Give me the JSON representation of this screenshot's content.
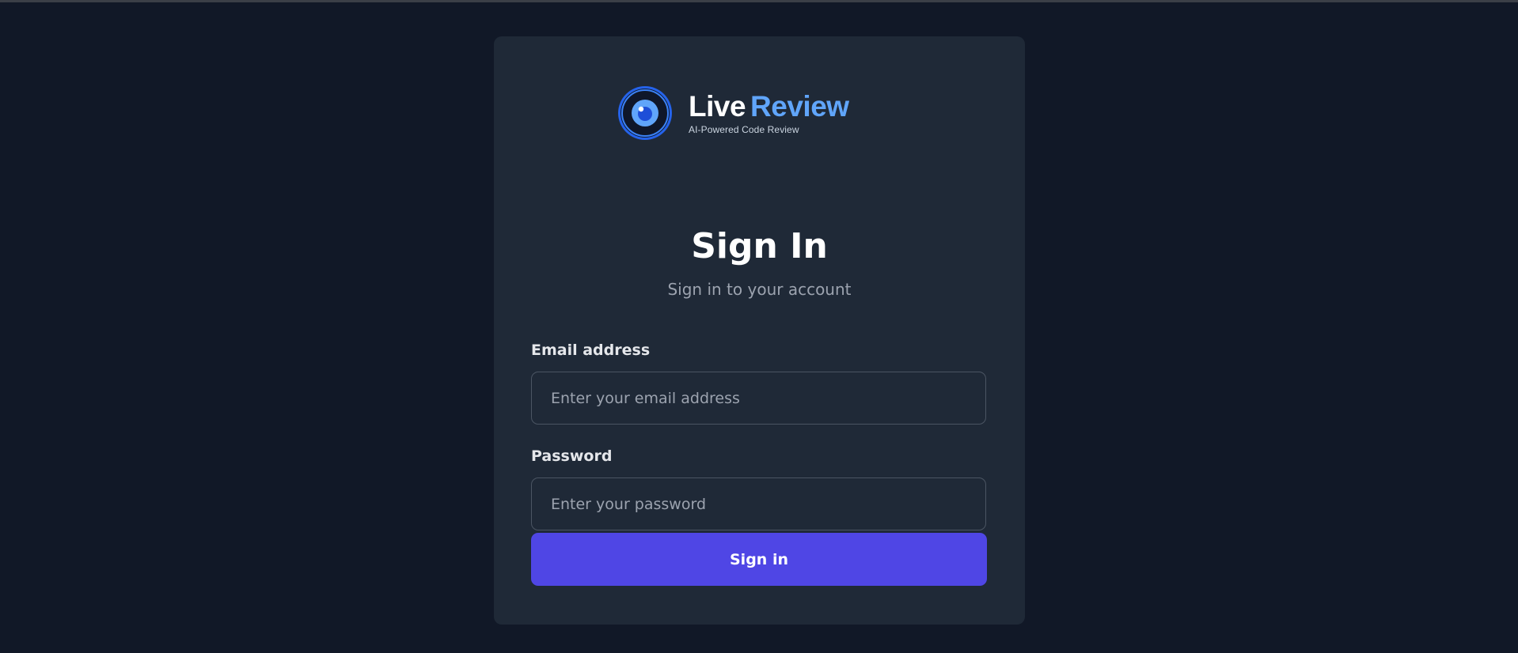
{
  "brand": {
    "name_part1": "Live",
    "name_part2": "Review",
    "tagline": "AI-Powered Code Review",
    "accent_color": "#60a5fa",
    "logo_icon": "eye-icon"
  },
  "form": {
    "title": "Sign In",
    "subtitle": "Sign in to your account",
    "email": {
      "label": "Email address",
      "placeholder": "Enter your email address",
      "value": ""
    },
    "password": {
      "label": "Password",
      "placeholder": "Enter your password",
      "value": ""
    },
    "submit_label": "Sign in",
    "submit_color": "#4f46e5"
  },
  "colors": {
    "page_background": "#111827",
    "card_background": "#1f2937"
  }
}
